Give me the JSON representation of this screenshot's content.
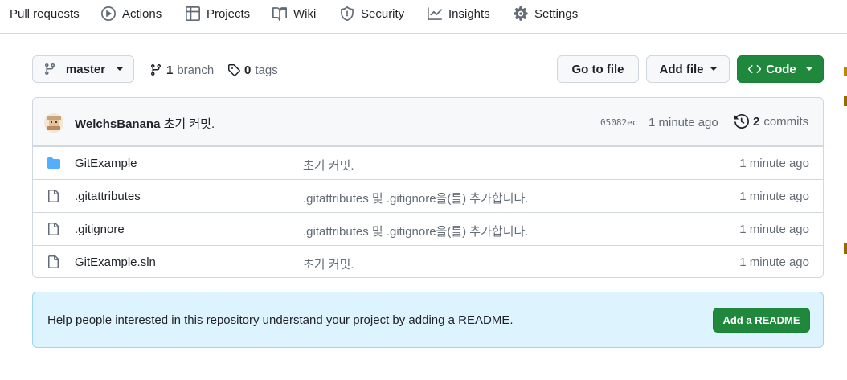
{
  "nav": {
    "items": [
      {
        "label": "Pull requests",
        "icon": "pull-request-icon"
      },
      {
        "label": "Actions",
        "icon": "play-icon"
      },
      {
        "label": "Projects",
        "icon": "table-icon"
      },
      {
        "label": "Wiki",
        "icon": "book-icon"
      },
      {
        "label": "Security",
        "icon": "shield-icon"
      },
      {
        "label": "Insights",
        "icon": "graph-icon"
      },
      {
        "label": "Settings",
        "icon": "gear-icon"
      }
    ]
  },
  "toolbar": {
    "branch_select": "master",
    "branch_count": "1",
    "branch_label": "branch",
    "tag_count": "0",
    "tag_label": "tags",
    "go_to_file": "Go to file",
    "add_file": "Add file",
    "code": "Code"
  },
  "commit": {
    "author": "WelchsBanana",
    "message": "초기 커밋.",
    "sha": "05082ec",
    "time": "1 minute ago",
    "count": "2",
    "count_label": "commits"
  },
  "files": [
    {
      "name": "GitExample",
      "type": "folder",
      "message": "초기 커밋.",
      "time": "1 minute ago"
    },
    {
      "name": ".gitattributes",
      "type": "file",
      "message": ".gitattributes 및 .gitignore을(를) 추가합니다.",
      "time": "1 minute ago"
    },
    {
      "name": ".gitignore",
      "type": "file",
      "message": ".gitattributes 및 .gitignore을(를) 추가합니다.",
      "time": "1 minute ago"
    },
    {
      "name": "GitExample.sln",
      "type": "file",
      "message": "초기 커밋.",
      "time": "1 minute ago"
    }
  ],
  "readme": {
    "text": "Help people interested in this repository understand your project by adding a README.",
    "button": "Add a README"
  },
  "colors": {
    "primary_green": "#1f883d",
    "folder_blue": "#54aeff",
    "banner_bg": "#ddf4ff",
    "muted_text": "#636c76"
  }
}
